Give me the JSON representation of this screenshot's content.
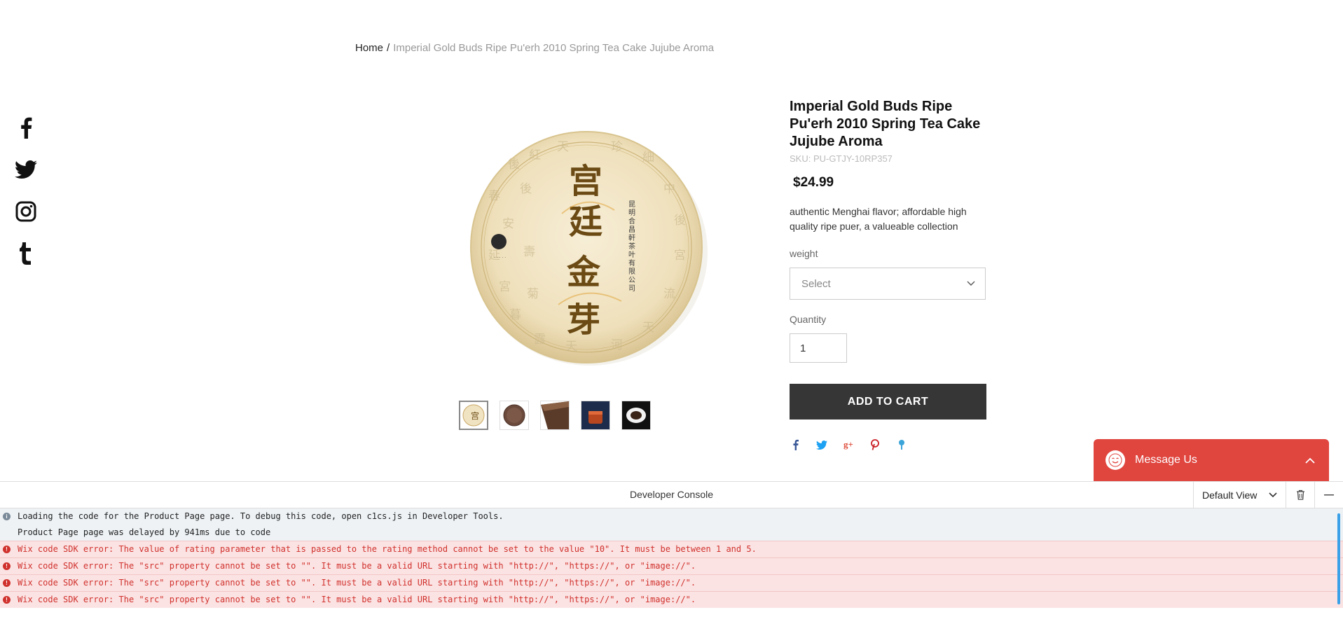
{
  "breadcrumb": {
    "home": "Home",
    "separator": "/",
    "current": "Imperial Gold Buds Ripe Pu'erh 2010 Spring Tea Cake Jujube Aroma"
  },
  "social": [
    "facebook-icon",
    "twitter-icon",
    "instagram-icon",
    "tumblr-icon"
  ],
  "product": {
    "title": "Imperial Gold Buds Ripe Pu'erh 2010 Spring Tea Cake Jujube Aroma",
    "sku": "SKU: PU-GTJY-10RP357",
    "price": "$24.99",
    "description": "authentic Menghai flavor; affordable high quality ripe puer, a valueable collection",
    "weight_label": "weight",
    "weight_placeholder": "Select",
    "quantity_label": "Quantity",
    "quantity_value": "1",
    "add_to_cart": "ADD TO CART",
    "thumbnail_count": 5,
    "cake_text_main": "宫廷金芽"
  },
  "share_icons": [
    "facebook-icon",
    "twitter-icon",
    "google-plus-icon",
    "pinterest-icon",
    "tumblr-icon"
  ],
  "message_widget": {
    "label": "Message Us"
  },
  "console": {
    "title": "Developer Console",
    "view": "Default View",
    "logs": [
      {
        "level": "info",
        "text": "Loading the code for the Product Page page. To debug this code, open c1cs.js in Developer Tools."
      },
      {
        "level": "info-cont",
        "text": "Product Page page was delayed by 941ms due to code"
      },
      {
        "level": "error",
        "text": "Wix code SDK error: The value of rating parameter that is passed to the rating method cannot be set to the value \"10\". It must be between 1 and 5."
      },
      {
        "level": "error",
        "text": "Wix code SDK error: The \"src\" property cannot be set to \"\". It must be a valid URL starting with \"http://\", \"https://\", or \"image://\"."
      },
      {
        "level": "error",
        "text": "Wix code SDK error: The \"src\" property cannot be set to \"\". It must be a valid URL starting with \"http://\", \"https://\", or \"image://\"."
      },
      {
        "level": "error",
        "text": "Wix code SDK error: The \"src\" property cannot be set to \"\". It must be a valid URL starting with \"http://\", \"https://\", or \"image://\"."
      }
    ]
  },
  "colors": {
    "button_dark": "#363636",
    "message_red": "#e0453e",
    "error_red": "#d0312d",
    "error_bg": "#fbe3e3"
  }
}
